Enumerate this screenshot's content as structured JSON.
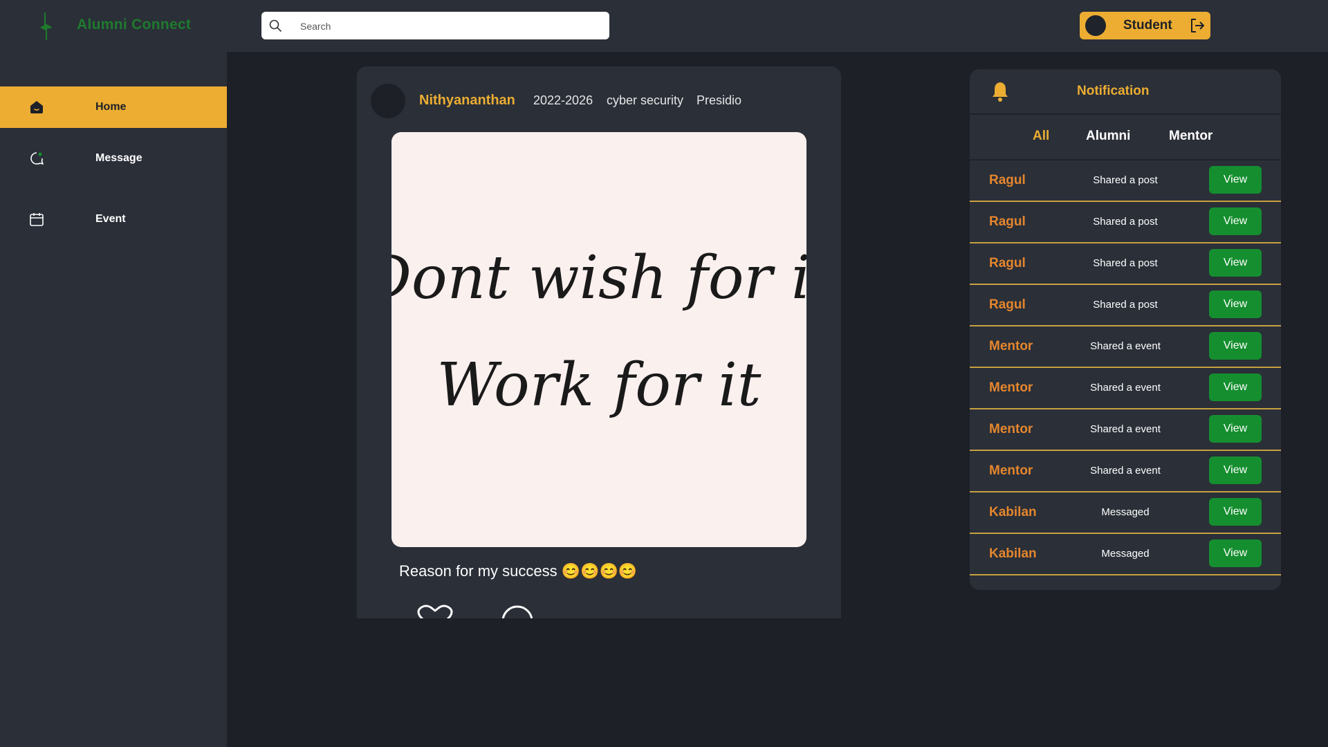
{
  "header": {
    "brand": "Alumni Connect",
    "brand_color": "#1f7a2e",
    "search_placeholder": "Search",
    "user_role": "Student",
    "icons": [
      "lightning-logo-icon",
      "search-icon",
      "logout-icon"
    ]
  },
  "sidebar": {
    "items": [
      {
        "label": "Home",
        "icon": "home-icon",
        "active": true
      },
      {
        "label": "Message",
        "icon": "message-icon",
        "active": false
      },
      {
        "label": "Event",
        "icon": "calendar-icon",
        "active": false
      }
    ],
    "active_color": "#ecad32"
  },
  "post": {
    "author": "Nithyananthan",
    "batch": "2022-2026",
    "department": "cyber security",
    "company": "Presidio",
    "image_text_line1": "Dont wish for it",
    "image_text_line2": "Work for it",
    "caption": "Reason for my success 😊😊😊😊",
    "icons": [
      "heart-icon",
      "comment-icon"
    ]
  },
  "notifications": {
    "title": "Notification",
    "tabs": [
      {
        "label": "All",
        "active": true
      },
      {
        "label": "Alumni",
        "active": false
      },
      {
        "label": "Mentor",
        "active": false
      }
    ],
    "items": [
      {
        "name": "Ragul",
        "action": "Shared a post",
        "button": "View"
      },
      {
        "name": "Ragul",
        "action": "Shared a post",
        "button": "View"
      },
      {
        "name": "Ragul",
        "action": "Shared a post",
        "button": "View"
      },
      {
        "name": "Ragul",
        "action": "Shared a post",
        "button": "View"
      },
      {
        "name": "Mentor",
        "action": "Shared a event",
        "button": "View"
      },
      {
        "name": "Mentor",
        "action": "Shared a event",
        "button": "View"
      },
      {
        "name": "Mentor",
        "action": "Shared a event",
        "button": "View"
      },
      {
        "name": "Mentor",
        "action": "Shared a event",
        "button": "View"
      },
      {
        "name": "Kabilan",
        "action": "Messaged",
        "button": "View"
      },
      {
        "name": "Kabilan",
        "action": "Messaged",
        "button": "View"
      }
    ],
    "accent": "#ecad32",
    "button_color": "#158e2f"
  }
}
